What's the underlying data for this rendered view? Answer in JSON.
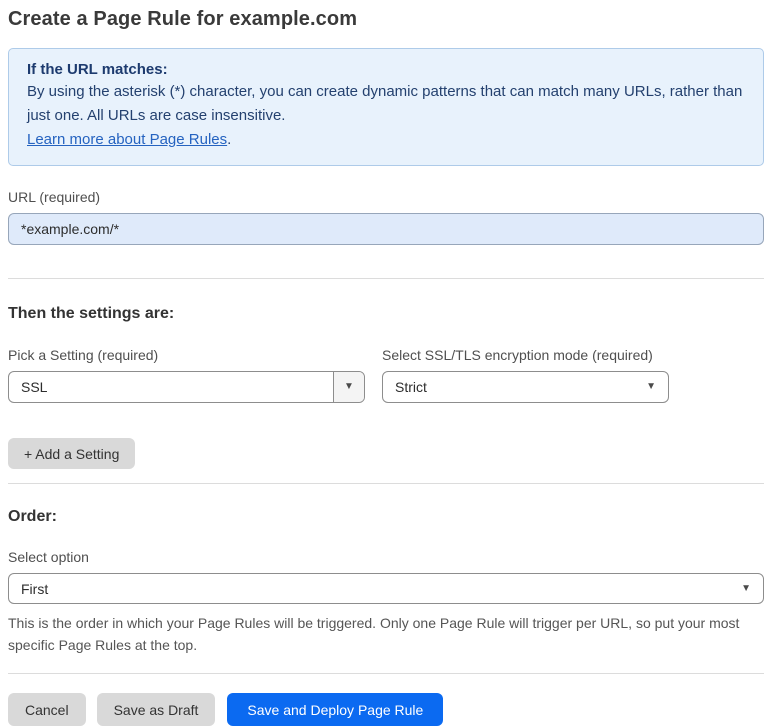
{
  "page": {
    "title": "Create a Page Rule for example.com"
  },
  "info_box": {
    "heading": "If the URL matches:",
    "body": "By using the asterisk (*) character, you can create dynamic patterns that can match many URLs, rather than just one. All URLs are case insensitive.",
    "link_label": "Learn more about Page Rules",
    "link_suffix": "."
  },
  "url_field": {
    "label": "URL (required)",
    "value": "*example.com/*"
  },
  "settings": {
    "heading": "Then the settings are:",
    "pick_setting": {
      "label": "Pick a Setting (required)",
      "value": "SSL"
    },
    "ssl_mode": {
      "label": "Select SSL/TLS encryption mode (required)",
      "value": "Strict"
    },
    "add_setting_label": "+ Add a Setting"
  },
  "order": {
    "heading": "Order:",
    "select_label": "Select option",
    "value": "First",
    "help_text": "This is the order in which your Page Rules will be triggered. Only one Page Rule will trigger per URL, so put your most specific Page Rules at the top."
  },
  "footer": {
    "cancel_label": "Cancel",
    "save_draft_label": "Save as Draft",
    "save_deploy_label": "Save and Deploy Page Rule"
  },
  "icons": {
    "dropdown_arrow": "▼"
  },
  "colors": {
    "accent_blue": "#0b6af1",
    "info_bg": "#e8f2fc",
    "info_border": "#aecbe9",
    "info_text": "#24416f",
    "link_blue": "#2563c0",
    "input_bg": "#dfeafa",
    "button_gray": "#d9d9d9"
  }
}
